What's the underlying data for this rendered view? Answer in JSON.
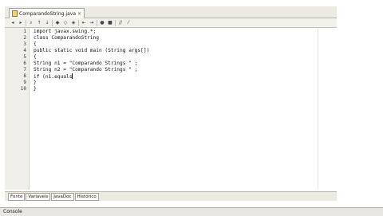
{
  "file_tab": {
    "label": "ComparandoString.java",
    "close": "×"
  },
  "code_lines": [
    {
      "num": "1",
      "text": "import javax.swing.*;"
    },
    {
      "num": "2",
      "text": "class ComparandoString"
    },
    {
      "num": "3",
      "text": "{"
    },
    {
      "num": "4",
      "text": "public static void main (String args[])"
    },
    {
      "num": "5",
      "text": "{"
    },
    {
      "num": "6",
      "text": "String n1 = \"Comparando Strings \" ;"
    },
    {
      "num": "7",
      "text": "String n2 = \"Comparando Strings \" ;"
    },
    {
      "num": "8",
      "text": "if (n1.equals"
    },
    {
      "num": "9",
      "text": "}"
    },
    {
      "num": "10",
      "text": "}"
    }
  ],
  "bottom_tabs": [
    "Fonte",
    "Variaveis",
    "JavaDoc",
    "Histórico"
  ],
  "console": {
    "label": "Console"
  }
}
